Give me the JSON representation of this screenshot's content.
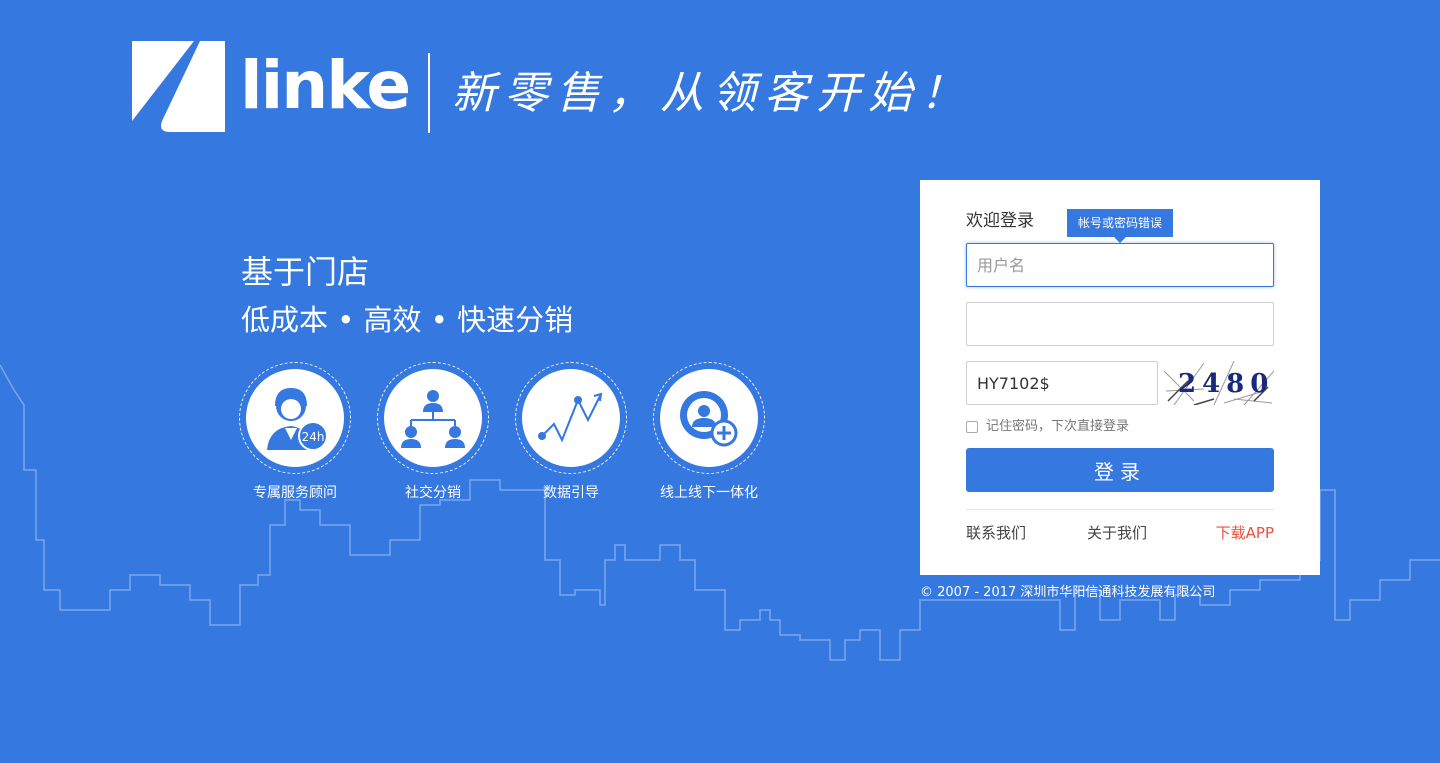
{
  "header": {
    "logo_text": "linke",
    "slogan": "新零售，从领客开始！"
  },
  "promo": {
    "title": "基于门店",
    "subtitle": "低成本 • 高效 • 快速分销",
    "features": [
      {
        "label": "专属服务顾问",
        "icon": "customer-service-24h-icon"
      },
      {
        "label": "社交分销",
        "icon": "org-network-icon"
      },
      {
        "label": "数据引导",
        "icon": "line-chart-icon"
      },
      {
        "label": "线上线下一体化",
        "icon": "user-add-icon"
      }
    ],
    "service_badge": "24h"
  },
  "login": {
    "welcome": "欢迎登录",
    "error_tip": "帐号或密码错误",
    "username_placeholder": "用户名",
    "username_value": "",
    "password_value": "",
    "code_value": "HY7102$",
    "captcha_text": "2480",
    "remember_label": "记住密码，下次直接登录",
    "remember_checked": false,
    "submit_label": "登录",
    "links": {
      "contact": "联系我们",
      "about": "关于我们",
      "download": "下载APP"
    }
  },
  "footer": {
    "copyright": "© 2007 - 2017 深圳市华阳信通科技发展有限公司"
  },
  "colors": {
    "background": "#3478e0",
    "accent": "#3478e0",
    "download_link": "#e8523f"
  }
}
